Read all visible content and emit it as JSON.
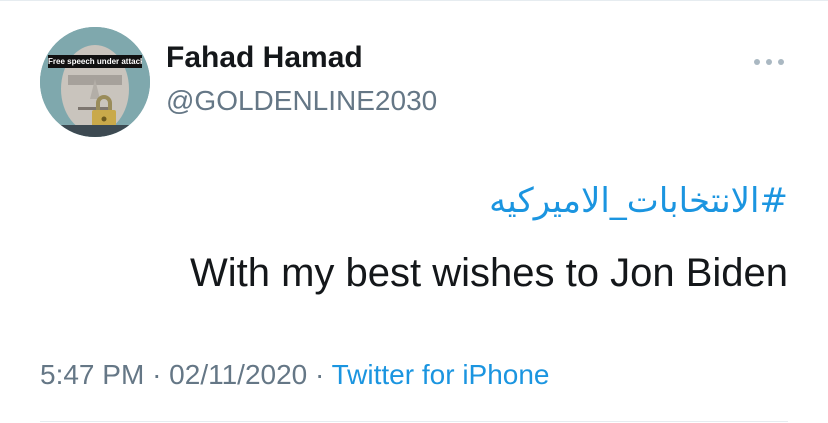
{
  "user": {
    "display_name": "Fahad Hamad",
    "handle": "@GOLDENLINE2030",
    "avatar_caption": "Free speech under attack"
  },
  "menu": {
    "icon": "more-horizontal-icon"
  },
  "tweet": {
    "hashtag": "#الانتخابات_الاميركيه",
    "text": "With my best wishes to Jon Biden"
  },
  "meta": {
    "time": "5:47 PM",
    "separator": "·",
    "date": "02/11/2020",
    "source": "Twitter for iPhone"
  },
  "colors": {
    "link": "#1b95e0",
    "text": "#14171a",
    "secondary": "#657786"
  }
}
